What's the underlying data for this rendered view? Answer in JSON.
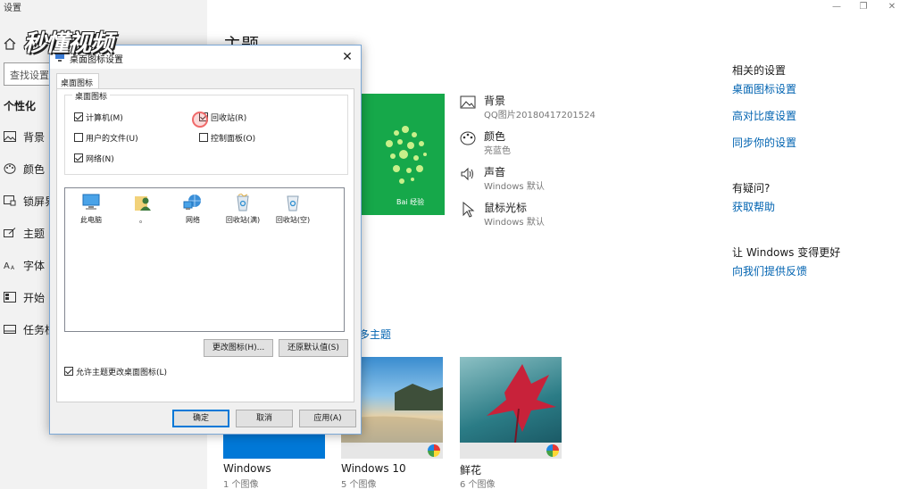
{
  "app": {
    "title": "设置"
  },
  "watermark": "秒懂视频",
  "sidebar": {
    "search_placeholder": "查找设置",
    "section": "个性化",
    "items": [
      {
        "label": "背景",
        "icon": "picture-icon"
      },
      {
        "label": "颜色",
        "icon": "palette-icon"
      },
      {
        "label": "锁屏界",
        "icon": "lockscreen-icon"
      },
      {
        "label": "主题",
        "icon": "theme-icon"
      },
      {
        "label": "字体",
        "icon": "font-icon"
      },
      {
        "label": "开始",
        "icon": "start-icon"
      },
      {
        "label": "任务栏",
        "icon": "taskbar-icon"
      }
    ]
  },
  "main": {
    "title": "主题",
    "preview_brand": "Bai 经验",
    "props": [
      {
        "name": "背景",
        "value": "QQ图片20180417201524",
        "icon": "picture-icon"
      },
      {
        "name": "颜色",
        "value": "亮蓝色",
        "icon": "palette-icon"
      },
      {
        "name": "声音",
        "value": "Windows 默认",
        "icon": "speaker-icon"
      },
      {
        "name": "鼠标光标",
        "value": "Windows 默认",
        "icon": "cursor-icon"
      }
    ],
    "more_themes": "多主题",
    "themes": [
      {
        "name": "Windows",
        "count": "1 个图像"
      },
      {
        "name": "Windows 10",
        "count": "5 个图像"
      },
      {
        "name": "鲜花",
        "count": "6 个图像"
      }
    ],
    "related": {
      "heading": "相关的设置",
      "links": [
        "桌面图标设置",
        "高对比度设置",
        "同步你的设置"
      ]
    },
    "question": {
      "heading": "有疑问?",
      "link": "获取帮助"
    },
    "feedback": {
      "heading": "让 Windows 变得更好",
      "link": "向我们提供反馈"
    }
  },
  "dialog": {
    "title": "桌面图标设置",
    "tab": "桌面图标",
    "group_label": "桌面图标",
    "checkboxes": [
      {
        "label": "计算机(M)",
        "checked": true
      },
      {
        "label": "回收站(R)",
        "checked": true
      },
      {
        "label": "用户的文件(U)",
        "checked": false
      },
      {
        "label": "控制面板(O)",
        "checked": false
      },
      {
        "label": "网络(N)",
        "checked": true
      }
    ],
    "icons": [
      {
        "label": "此电脑",
        "icon": "computer-icon"
      },
      {
        "label": "。",
        "icon": "user-icon"
      },
      {
        "label": "网络",
        "icon": "network-icon"
      },
      {
        "label": "回收站(满)",
        "icon": "recycle-bin-full-icon"
      },
      {
        "label": "回收站(空)",
        "icon": "recycle-bin-empty-icon"
      }
    ],
    "change_icon": "更改图标(H)...",
    "restore_default": "还原默认值(S)",
    "allow_themes": {
      "label": "允许主题更改桌面图标(L)",
      "checked": true
    },
    "ok": "确定",
    "cancel": "取消",
    "apply": "应用(A)"
  }
}
